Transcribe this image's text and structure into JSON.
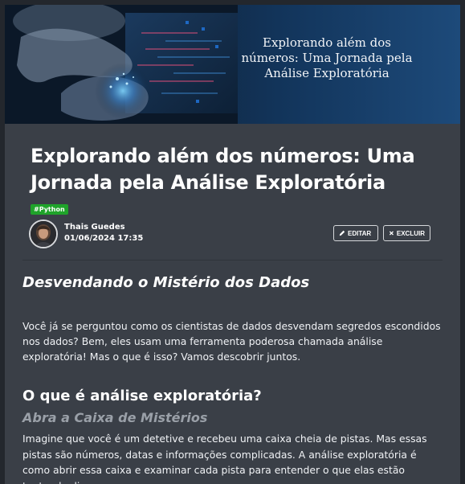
{
  "banner": {
    "title": "Explorando além dos números: Uma Jornada pela Análise Exploratória"
  },
  "post": {
    "title": "Explorando além dos números: Uma Jornada pela Análise Exploratória",
    "tag": "#Python",
    "author": "Thais Guedes",
    "date": "01/06/2024 17:35",
    "edit_label": "EDITAR",
    "delete_label": "EXCLUIR"
  },
  "article": {
    "heading1": "Desvendando o Mistério dos Dados",
    "paragraph1": "Você já se perguntou como os cientistas de dados desvendam segredos escondidos nos dados? Bem, eles usam uma ferramenta poderosa chamada análise exploratória! Mas o que é isso? Vamos descobrir juntos.",
    "heading2": "O que é análise exploratória?",
    "heading3": "Abra a Caixa de Mistérios",
    "paragraph2": "Imagine que você é um detetive e recebeu uma caixa cheia de pistas. Mas essas pistas são números, datas e informações complicadas. A análise exploratória é como abrir essa caixa e examinar cada pista para entender o que elas estão tentando dizer."
  },
  "colors": {
    "background": "#3a3f47",
    "tag": "#1fa32a",
    "heading_muted": "#9aa0a8"
  }
}
